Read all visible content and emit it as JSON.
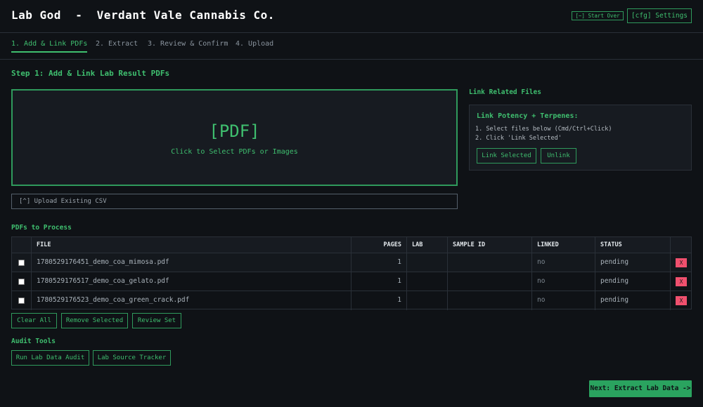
{
  "header": {
    "title": "Lab God  -  Verdant Vale Cannabis Co.",
    "start_over": "[~] Start Over",
    "settings": "[cfg] Settings"
  },
  "tabs": [
    {
      "label": "1. Add & Link PDFs",
      "active": true
    },
    {
      "label": "2. Extract",
      "active": false
    },
    {
      "label": "3. Review & Confirm",
      "active": false
    },
    {
      "label": "4. Upload",
      "active": false
    }
  ],
  "step": {
    "heading": "Step 1: Add & Link Lab Result PDFs",
    "dropzone_icon": "[PDF]",
    "dropzone_text": "Click to Select PDFs or Images",
    "upload_csv": "[^] Upload Existing CSV"
  },
  "link_panel": {
    "heading": "Link Related Files",
    "title": "Link Potency + Terpenes:",
    "instruction_1": "1. Select files below (Cmd/Ctrl+Click)",
    "instruction_2": "2. Click 'Link Selected'",
    "link_selected": "Link Selected",
    "unlink": "Unlink"
  },
  "table": {
    "heading": "PDFs to Process",
    "columns": [
      "FILE",
      "PAGES",
      "LAB",
      "SAMPLE ID",
      "LINKED",
      "STATUS"
    ],
    "rows": [
      {
        "file": "1780529176451_demo_coa_mimosa.pdf",
        "pages": "1",
        "lab": "",
        "sample_id": "",
        "linked": "no",
        "status": "pending",
        "remove": "X"
      },
      {
        "file": "1780529176517_demo_coa_gelato.pdf",
        "pages": "1",
        "lab": "",
        "sample_id": "",
        "linked": "no",
        "status": "pending",
        "remove": "X"
      },
      {
        "file": "1780529176523_demo_coa_green_crack.pdf",
        "pages": "1",
        "lab": "",
        "sample_id": "",
        "linked": "no",
        "status": "pending",
        "remove": "X"
      }
    ]
  },
  "actions": {
    "clear_all": "Clear All",
    "remove_selected": "Remove Selected",
    "review_set": "Review Set"
  },
  "audit": {
    "heading": "Audit Tools",
    "run_audit": "Run Lab Data Audit",
    "source_tracker": "Lab Source Tracker"
  },
  "next": "Next: Extract Lab Data ->",
  "colors": {
    "accent": "#3fbf6f",
    "background": "#0f1216",
    "danger": "#f0506e"
  }
}
